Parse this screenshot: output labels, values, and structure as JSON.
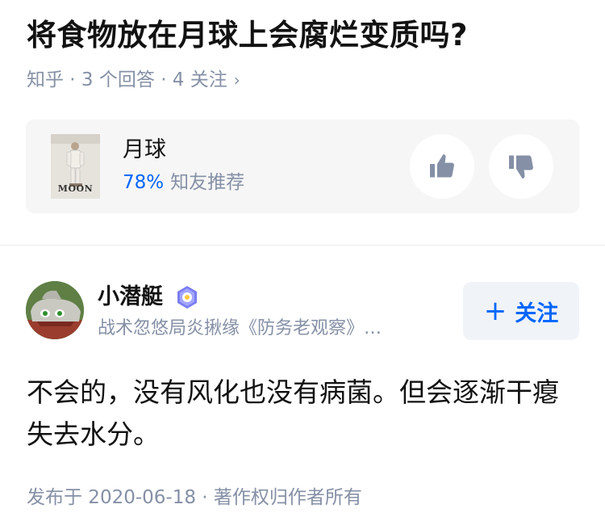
{
  "question": {
    "title": "将食物放在月球上会腐烂变质吗?",
    "meta": "知乎 · 3 个回答 · 4 关注",
    "meta_chevron": "›"
  },
  "movie_card": {
    "title": "月球",
    "poster_text": "MOON",
    "recommend_percent": "78%",
    "recommend_label": "知友推荐",
    "like_icon": "thumbs-up-icon",
    "dislike_icon": "thumbs-down-icon"
  },
  "answer": {
    "author_name": "小潜艇",
    "author_bio": "战术忽悠局炎揪缘《防务老观察》…",
    "follow_label": "关注",
    "follow_plus": "+",
    "content": "不会的，没有风化也没有病菌。但会逐渐干瘪失去水分。",
    "footer": "发布于 2020-06-18 · 著作权归作者所有"
  },
  "colors": {
    "accent": "#0066ff",
    "muted": "#8590a6",
    "card_bg": "#f6f6f6",
    "text": "#121212"
  }
}
